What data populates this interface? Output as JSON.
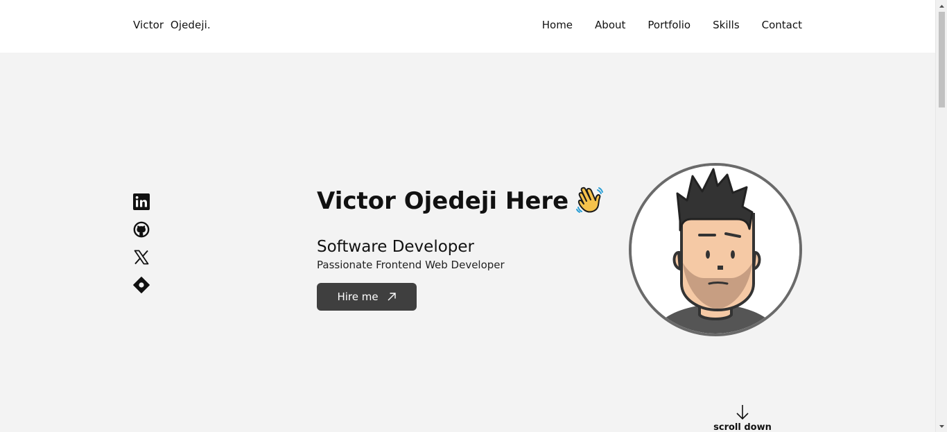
{
  "header": {
    "logo": "Victor  Ojedeji.",
    "nav": [
      "Home",
      "About",
      "Portfolio",
      "Skills",
      "Contact"
    ]
  },
  "socials": [
    {
      "icon": "linkedin-icon"
    },
    {
      "icon": "github-icon"
    },
    {
      "icon": "x-twitter-icon"
    },
    {
      "icon": "hashnode-icon"
    }
  ],
  "hero": {
    "title": "Victor Ojedeji Here",
    "wave_icon": "waving-hand-icon",
    "role": "Software Developer",
    "subtitle": "Passionate Frontend Web Developer",
    "cta_label": "Hire me",
    "cta_icon": "arrow-up-right-icon"
  },
  "avatar": {
    "icon": "cartoon-avatar"
  },
  "scroll": {
    "label": "scroll down",
    "icon": "arrow-down-icon"
  },
  "colors": {
    "background": "#f3f3f3",
    "header": "#ffffff",
    "button": "#3f3f3f",
    "avatar_border": "#6a6a6a"
  }
}
